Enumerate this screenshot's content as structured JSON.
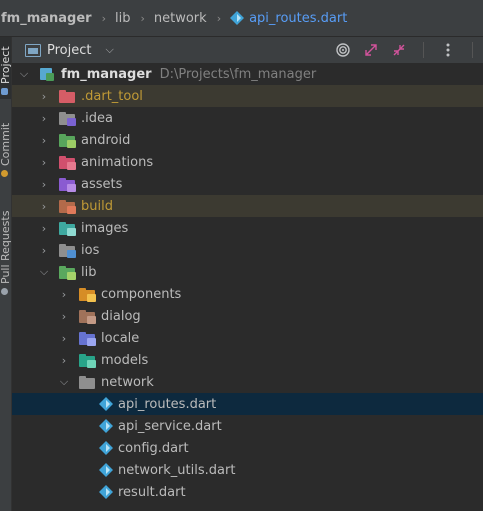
{
  "breadcrumb": [
    {
      "label": "fm_manager",
      "icon": "folder-icon"
    },
    {
      "label": "lib",
      "icon": ""
    },
    {
      "label": "network",
      "icon": ""
    },
    {
      "label": "api_routes.dart",
      "icon": "dart-file-icon"
    }
  ],
  "side_tabs": {
    "project": "Project",
    "commit": "Commit",
    "pull_requests": "Pull Requests"
  },
  "panel": {
    "title": "Project",
    "tools": [
      "locate-icon",
      "expand-all-icon",
      "collapse-all-icon",
      "more-icon"
    ]
  },
  "tree": [
    {
      "label": "fm_manager",
      "path": "D:\\Projects\\fm_manager",
      "expanded": true,
      "root": true
    },
    {
      "label": ".dart_tool",
      "excluded": true,
      "folder_color": "#d65d66"
    },
    {
      "label": ".idea",
      "folder_color": "#7a62d1"
    },
    {
      "label": "android",
      "folder_color": "#58a55c"
    },
    {
      "label": "animations",
      "folder_color": "#d1506d"
    },
    {
      "label": "assets",
      "folder_color": "#8a5bd1"
    },
    {
      "label": "build",
      "excluded": true,
      "folder_color": "#b36a4a"
    },
    {
      "label": "images",
      "folder_color": "#3ea9a0"
    },
    {
      "label": "ios",
      "folder_color": "#4f8fd1"
    },
    {
      "label": "lib",
      "expanded": true,
      "folder_color": "#5aa85e"
    },
    {
      "label": "components",
      "folder_color": "#d68d26"
    },
    {
      "label": "dialog",
      "folder_color": "#a0725a"
    },
    {
      "label": "locale",
      "folder_color": "#6673d1"
    },
    {
      "label": "models",
      "folder_color": "#28a489"
    },
    {
      "label": "network",
      "expanded": true,
      "folder_color": "#8f8f8f"
    },
    {
      "label": "api_routes.dart",
      "selected": true
    },
    {
      "label": "api_service.dart"
    },
    {
      "label": "config.dart"
    },
    {
      "label": "network_utils.dart"
    },
    {
      "label": "result.dart"
    }
  ],
  "colors": {
    "background": "#2b2b2b",
    "panel": "#3c3f41",
    "selection": "#0d293e",
    "excluded_text": "#c09a36",
    "dart": "#40a4d8"
  }
}
